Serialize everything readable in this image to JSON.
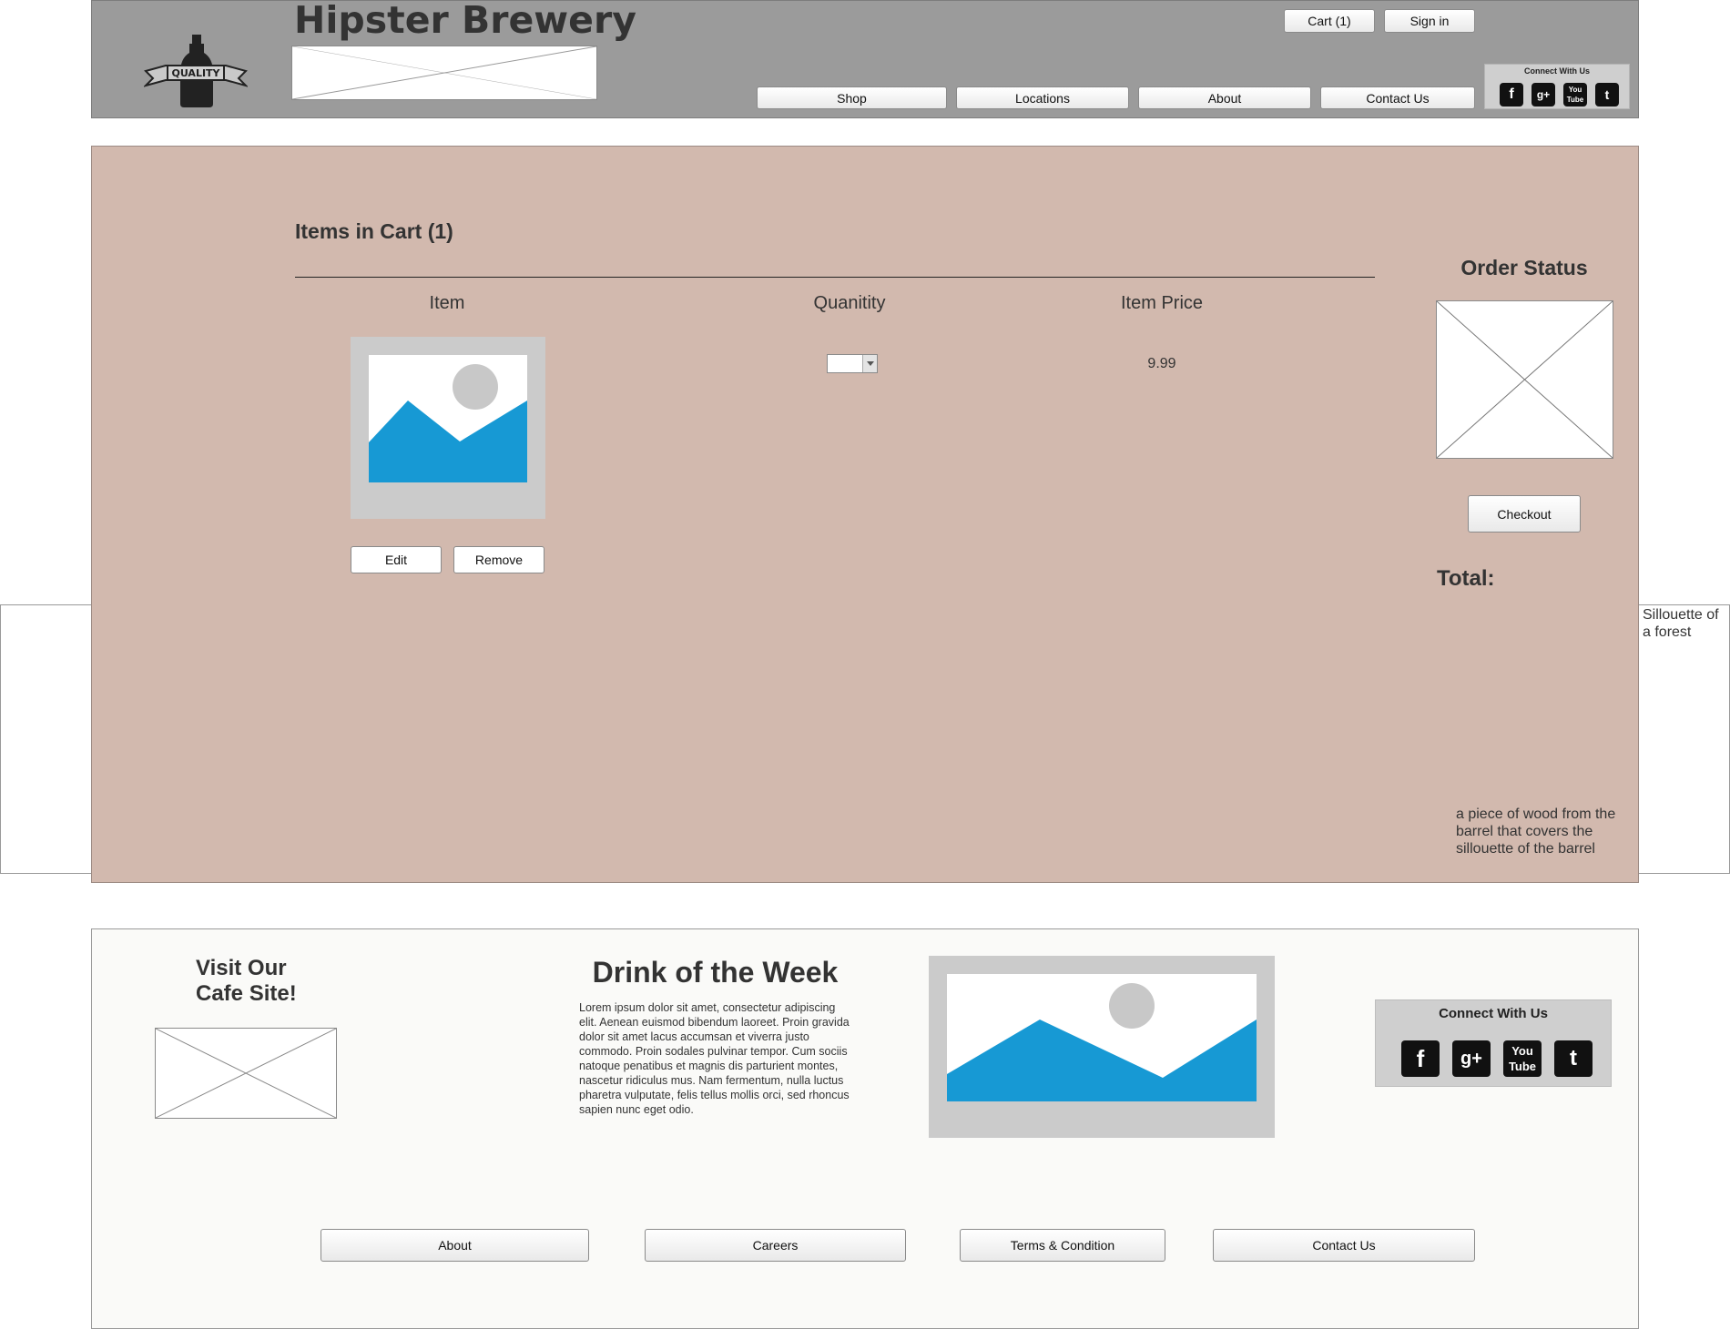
{
  "header": {
    "title": "Hipster Brewery",
    "logo_text": "QUALITY",
    "cart_button": "Cart (1)",
    "signin_button": "Sign in",
    "nav": [
      "Shop",
      "Locations",
      "About",
      "Contact Us"
    ],
    "connect_label": "Connect With Us"
  },
  "cart": {
    "heading": "Items in Cart (1)",
    "columns": {
      "item": "Item",
      "quantity": "Quanitity",
      "price": "Item Price"
    },
    "items": [
      {
        "price": "9.99"
      }
    ],
    "edit_button": "Edit",
    "remove_button": "Remove"
  },
  "order": {
    "heading": "Order Status",
    "checkout_button": "Checkout",
    "total_label": "Total:",
    "wood_note": "a piece of wood from the barrel that covers the sillouette of the barrel"
  },
  "side_note": "Sillouette of a forest",
  "footer": {
    "visit_line1": "Visit Our",
    "visit_line2": "Cafe Site!",
    "dotw_heading": "Drink of the Week",
    "dotw_text": "Lorem ipsum dolor sit amet, consectetur adipiscing elit. Aenean euismod bibendum laoreet. Proin gravida dolor sit amet lacus accumsan et viverra justo commodo. Proin sodales pulvinar tempor. Cum sociis natoque penatibus et magnis dis parturient montes, nascetur ridiculus mus. Nam fermentum, nulla luctus pharetra vulputate, felis tellus mollis orci, sed rhoncus sapien nunc eget odio.",
    "connect_label": "Connect With Us",
    "links": [
      "About",
      "Careers",
      "Terms & Condition",
      "Contact Us"
    ]
  },
  "colors": {
    "header_bg": "#9b9b9b",
    "main_bg": "#d2b9ae",
    "footer_bg": "#fafaf8",
    "image_blue": "#1799d4"
  },
  "icons": [
    "facebook-icon",
    "google-plus-icon",
    "youtube-icon",
    "twitter-icon",
    "image-placeholder-icon",
    "dropdown-arrow-icon"
  ]
}
